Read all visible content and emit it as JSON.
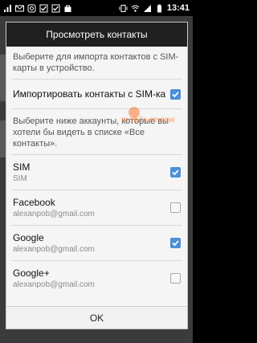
{
  "status_bar": {
    "icons": [
      "signal-bars-icon",
      "mail-icon",
      "instagram-icon",
      "checkbox-icon",
      "checkbox-icon",
      "bag-icon"
    ],
    "right_icons": [
      "vibrate-icon",
      "wifi-icon",
      "signal-icon",
      "battery-icon"
    ],
    "time": "13:41"
  },
  "dialog": {
    "title": "Просмотреть контакты",
    "import_hint": "Выберите для импорта контактов с SIM-карты в устройство.",
    "import_option": {
      "label": "Импортировать контакты с SIM-ка",
      "checked": true
    },
    "accounts_hint": "Выберите ниже аккаунты, которые вы хотели бы видеть в списке «Все контакты».",
    "accounts": [
      {
        "name": "SIM",
        "detail": "SIM",
        "checked": true
      },
      {
        "name": "Facebook",
        "detail": "alexanpob@gmail.com",
        "checked": false
      },
      {
        "name": "Google",
        "detail": "alexanpob@gmail.com",
        "checked": true
      },
      {
        "name": "Google+",
        "detail": "alexanpob@gmail.com",
        "checked": false
      }
    ],
    "ok_label": "OK"
  },
  "watermark": "mobile-review",
  "colors": {
    "check": "#4c8fd6",
    "header": "#202020",
    "body": "#f5f5f5"
  }
}
